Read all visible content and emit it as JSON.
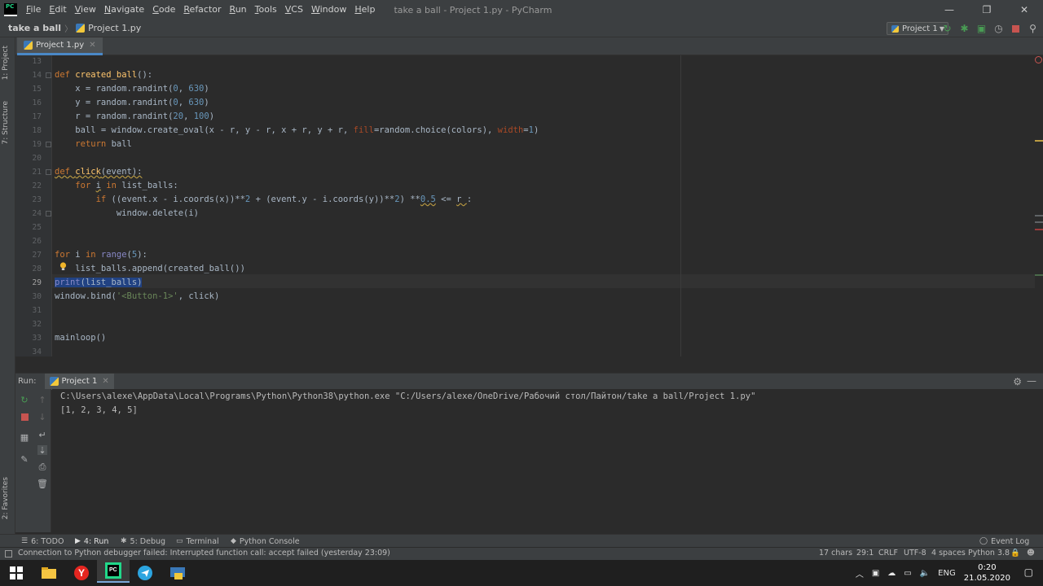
{
  "titlebar": {
    "logo_text": "PC",
    "menu": [
      "File",
      "Edit",
      "View",
      "Navigate",
      "Code",
      "Refactor",
      "Run",
      "Tools",
      "VCS",
      "Window",
      "Help"
    ],
    "window_title": "take a ball - Project 1.py - PyCharm"
  },
  "navbar": {
    "project": "take a ball",
    "file": "Project 1.py",
    "run_config": "Project 1"
  },
  "left_strip": {
    "project_tab": "1: Project",
    "structure_tab": "7: Structure",
    "favorites_tab": "2: Favorites"
  },
  "editor": {
    "tab": "Project 1.py",
    "current_line": "29",
    "line_numbers": [
      "13",
      "14",
      "15",
      "16",
      "17",
      "18",
      "19",
      "20",
      "21",
      "22",
      "23",
      "24",
      "25",
      "26",
      "27",
      "28",
      "29",
      "30",
      "31",
      "32",
      "33",
      "34"
    ]
  },
  "run_panel": {
    "label": "Run:",
    "tab": "Project 1",
    "output": [
      "C:\\Users\\alexe\\AppData\\Local\\Programs\\Python\\Python38\\python.exe \"C:/Users/alexe/OneDrive/Рабочий стол/Пайтон/take a ball/Project 1.py\"",
      "[1, 2, 3, 4, 5]"
    ]
  },
  "tool_windows": {
    "todo": "6: TODO",
    "run": "4: Run",
    "debug": "5: Debug",
    "terminal": "Terminal",
    "python_console": "Python Console",
    "event_log": "Event Log"
  },
  "status": {
    "message": "Connection to Python debugger failed: Interrupted function call: accept failed (yesterday 23:09)",
    "chars": "17 chars",
    "position": "29:1",
    "line_sep": "CRLF",
    "encoding": "UTF-8",
    "indent": "4 spaces",
    "interpreter": "Python 3.8"
  },
  "taskbar": {
    "language": "ENG",
    "time": "0:20",
    "date": "21.05.2020"
  },
  "colors": {
    "background": "#2b2b2b",
    "panel": "#3c3f41",
    "keyword": "#cc7832",
    "function": "#ffc66d",
    "number": "#6897bb",
    "string": "#6a8759",
    "selection": "#214283"
  }
}
